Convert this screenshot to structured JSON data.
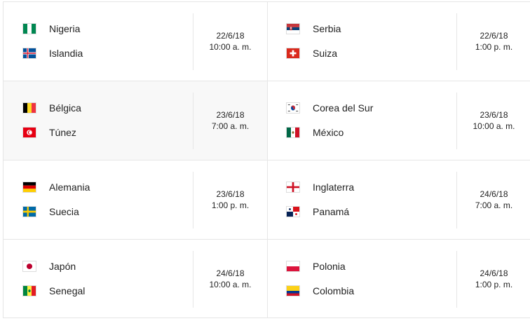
{
  "matches": [
    {
      "team1": {
        "name": "Nigeria",
        "flag": "nigeria-flag"
      },
      "team2": {
        "name": "Islandia",
        "flag": "iceland-flag"
      },
      "date": "22/6/18",
      "time": "10:00 a. m."
    },
    {
      "team1": {
        "name": "Serbia",
        "flag": "serbia-flag"
      },
      "team2": {
        "name": "Suiza",
        "flag": "switzerland-flag"
      },
      "date": "22/6/18",
      "time": "1:00 p. m."
    },
    {
      "team1": {
        "name": "Bélgica",
        "flag": "belgium-flag"
      },
      "team2": {
        "name": "Túnez",
        "flag": "tunisia-flag"
      },
      "date": "23/6/18",
      "time": "7:00 a. m."
    },
    {
      "team1": {
        "name": "Corea del Sur",
        "flag": "south-korea-flag"
      },
      "team2": {
        "name": "México",
        "flag": "mexico-flag"
      },
      "date": "23/6/18",
      "time": "10:00 a. m."
    },
    {
      "team1": {
        "name": "Alemania",
        "flag": "germany-flag"
      },
      "team2": {
        "name": "Suecia",
        "flag": "sweden-flag"
      },
      "date": "23/6/18",
      "time": "1:00 p. m."
    },
    {
      "team1": {
        "name": "Inglaterra",
        "flag": "england-flag"
      },
      "team2": {
        "name": "Panamá",
        "flag": "panama-flag"
      },
      "date": "24/6/18",
      "time": "7:00 a. m."
    },
    {
      "team1": {
        "name": "Japón",
        "flag": "japan-flag"
      },
      "team2": {
        "name": "Senegal",
        "flag": "senegal-flag"
      },
      "date": "24/6/18",
      "time": "10:00 a. m."
    },
    {
      "team1": {
        "name": "Polonia",
        "flag": "poland-flag"
      },
      "team2": {
        "name": "Colombia",
        "flag": "colombia-flag"
      },
      "date": "24/6/18",
      "time": "1:00 p. m."
    }
  ],
  "colors": {
    "border": "#e6e6e6",
    "highlight_background": "#f8f8f8",
    "text": "#222222"
  }
}
